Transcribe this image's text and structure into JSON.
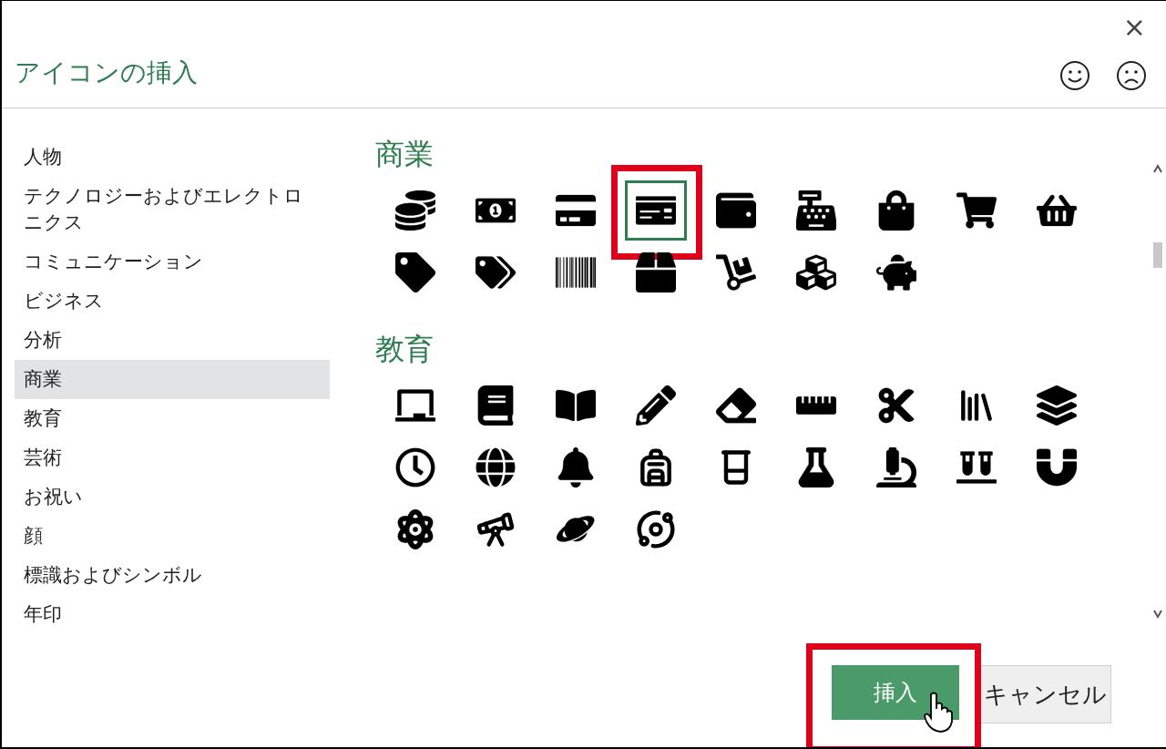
{
  "dialog": {
    "title": "アイコンの挿入",
    "close": "×"
  },
  "sidebar": {
    "items": [
      {
        "label": "人物",
        "selected": false
      },
      {
        "label": "テクノロジーおよびエレクトロニクス",
        "selected": false
      },
      {
        "label": "コミュニケーション",
        "selected": false
      },
      {
        "label": "ビジネス",
        "selected": false
      },
      {
        "label": "分析",
        "selected": false
      },
      {
        "label": "商業",
        "selected": true
      },
      {
        "label": "教育",
        "selected": false
      },
      {
        "label": "芸術",
        "selected": false
      },
      {
        "label": "お祝い",
        "selected": false
      },
      {
        "label": "顔",
        "selected": false
      },
      {
        "label": "標識およびシンボル",
        "selected": false
      },
      {
        "label": "年印",
        "selected": false
      }
    ]
  },
  "sections": [
    {
      "kind": "commerce",
      "heading": "商業",
      "icons": [
        {
          "selected": false
        },
        {
          "selected": false
        },
        {
          "selected": false
        },
        {
          "selected": true
        },
        {
          "selected": false
        },
        {
          "selected": false
        },
        {
          "selected": false
        },
        {
          "selected": false
        },
        {
          "selected": false
        },
        {
          "selected": false
        },
        {
          "selected": false
        },
        {
          "selected": false
        },
        {
          "selected": false
        },
        {
          "selected": false
        },
        {
          "selected": false
        },
        {
          "selected": false
        }
      ]
    },
    {
      "kind": "education",
      "heading": "教育",
      "icons": [
        {
          "selected": false
        },
        {
          "selected": false
        },
        {
          "selected": false
        },
        {
          "selected": false
        },
        {
          "selected": false
        },
        {
          "selected": false
        },
        {
          "selected": false
        },
        {
          "selected": false
        },
        {
          "selected": false
        },
        {
          "selected": false
        },
        {
          "selected": false
        },
        {
          "selected": false
        },
        {
          "selected": false
        },
        {
          "selected": false
        },
        {
          "selected": false
        },
        {
          "selected": false
        },
        {
          "selected": false
        },
        {
          "selected": false
        },
        {
          "selected": false
        },
        {
          "selected": false
        },
        {
          "selected": false
        },
        {
          "selected": false
        }
      ]
    }
  ],
  "buttons": [
    {
      "kind": "primary",
      "label": "挿入"
    },
    {
      "kind": "secondary",
      "label": "キャンセル"
    }
  ]
}
